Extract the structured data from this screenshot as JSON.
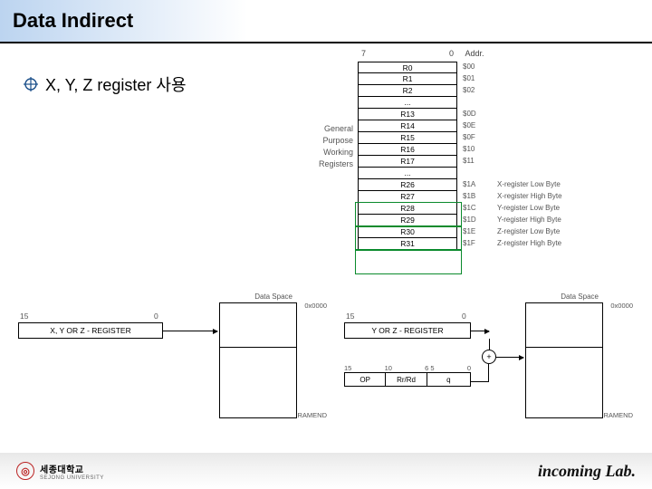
{
  "title": "Data Indirect",
  "bullet": "X, Y, Z register 사용",
  "reg_header": {
    "left": "7",
    "right": "0",
    "addr": "Addr."
  },
  "side_label": [
    "General",
    "Purpose",
    "Working",
    "Registers"
  ],
  "rows": [
    {
      "name": "R0",
      "addr": "$00",
      "note": ""
    },
    {
      "name": "R1",
      "addr": "$01",
      "note": ""
    },
    {
      "name": "R2",
      "addr": "$02",
      "note": ""
    },
    {
      "name": "...",
      "addr": "",
      "note": ""
    },
    {
      "name": "R13",
      "addr": "$0D",
      "note": ""
    },
    {
      "name": "R14",
      "addr": "$0E",
      "note": ""
    },
    {
      "name": "R15",
      "addr": "$0F",
      "note": ""
    },
    {
      "name": "R16",
      "addr": "$10",
      "note": ""
    },
    {
      "name": "R17",
      "addr": "$11",
      "note": ""
    },
    {
      "name": "...",
      "addr": "",
      "note": ""
    },
    {
      "name": "R26",
      "addr": "$1A",
      "note": "X-register Low Byte"
    },
    {
      "name": "R27",
      "addr": "$1B",
      "note": "X-register High Byte"
    },
    {
      "name": "R28",
      "addr": "$1C",
      "note": "Y-register Low Byte"
    },
    {
      "name": "R29",
      "addr": "$1D",
      "note": "Y-register High Byte"
    },
    {
      "name": "R30",
      "addr": "$1E",
      "note": "Z-register Low Byte"
    },
    {
      "name": "R31",
      "addr": "$1F",
      "note": "Z-register High Byte"
    }
  ],
  "left_panel": {
    "bits_hi": "15",
    "bits_lo": "0",
    "reg_label": "X, Y OR Z - REGISTER",
    "ds_label": "Data Space",
    "addr_top": "0x0000",
    "addr_bot": "RAMEND"
  },
  "right_panel": {
    "bits_hi": "15",
    "bits_lo": "0",
    "reg_label": "Y OR Z - REGISTER",
    "ds_label": "Data Space",
    "addr_top": "0x0000",
    "addr_bot": "RAMEND",
    "adder": "+",
    "op_bits": {
      "b15": "15",
      "b10": "10",
      "b65": "6 5",
      "b0": "0"
    },
    "op_cells": {
      "op": "OP",
      "rr": "Rr/Rd",
      "q": "q"
    }
  },
  "footer": {
    "uni_kr": "세종대학교",
    "uni_en": "SEJONG UNIVERSITY",
    "lab": "incoming Lab."
  }
}
